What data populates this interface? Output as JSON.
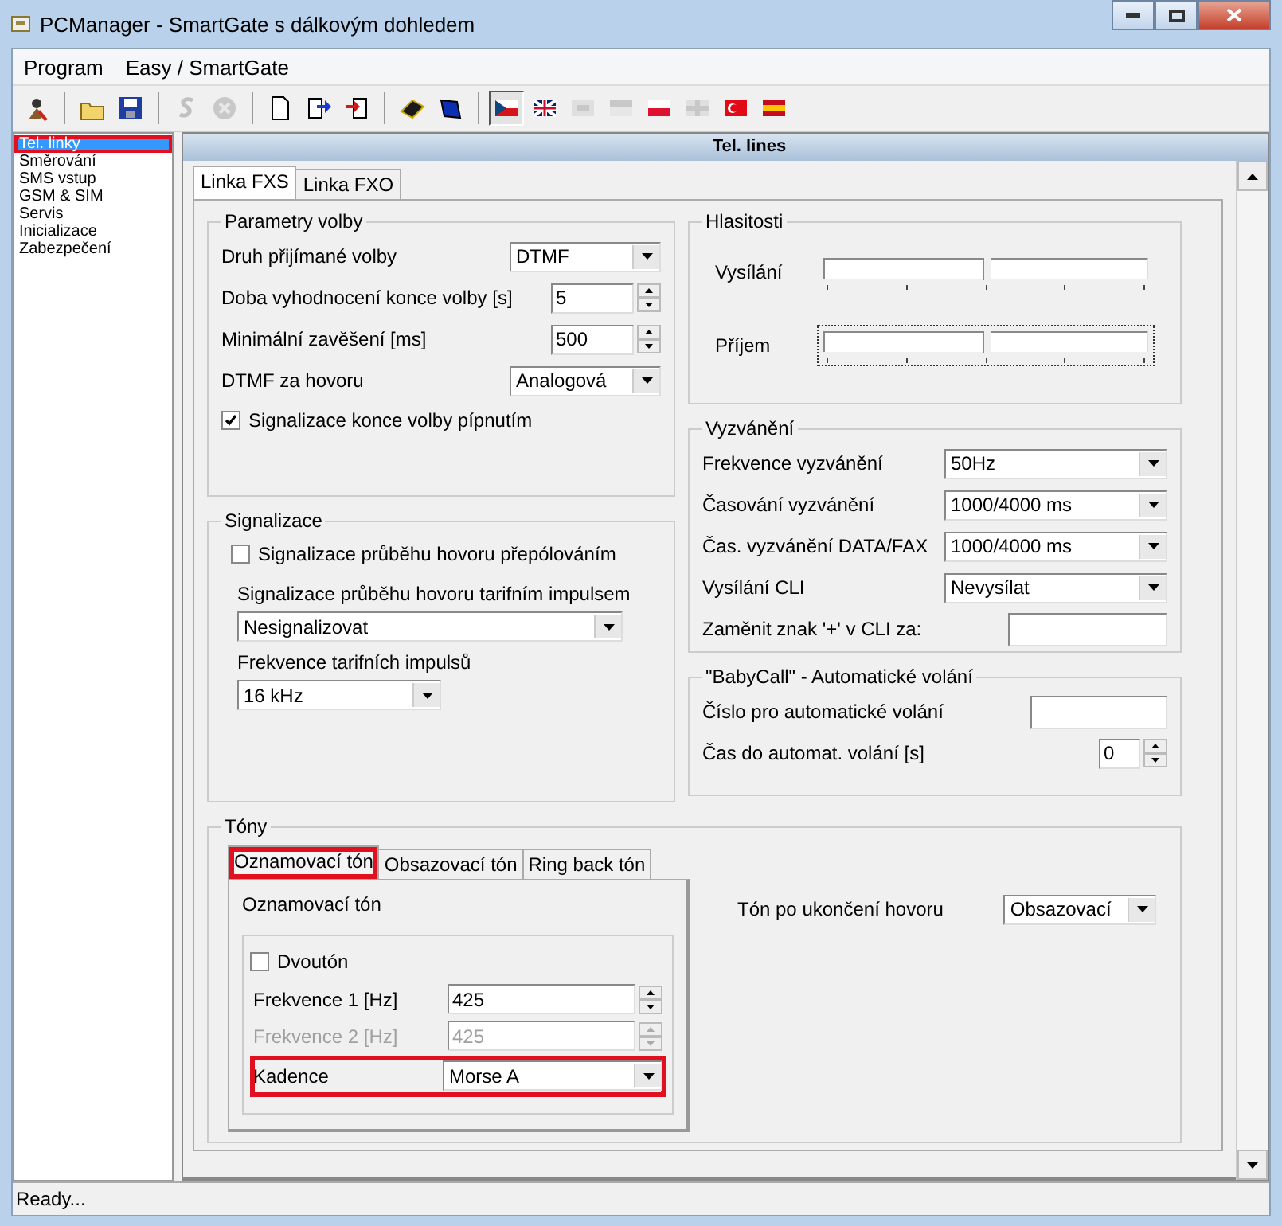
{
  "window": {
    "title": "PCManager - SmartGate s dálkovým dohledem"
  },
  "menu": [
    "Program",
    "Easy / SmartGate"
  ],
  "toolbar": [
    {
      "kind": "button",
      "disabled": false,
      "selected": false
    },
    {
      "kind": "separator"
    },
    {
      "kind": "button",
      "disabled": false,
      "selected": false
    },
    {
      "kind": "button",
      "disabled": false,
      "selected": false
    },
    {
      "kind": "separator"
    },
    {
      "kind": "button",
      "disabled": true,
      "selected": false
    },
    {
      "kind": "button",
      "disabled": true,
      "selected": false
    },
    {
      "kind": "separator"
    },
    {
      "kind": "button",
      "disabled": false,
      "selected": false
    },
    {
      "kind": "button",
      "disabled": false,
      "selected": false
    },
    {
      "kind": "button",
      "disabled": false,
      "selected": false
    },
    {
      "kind": "separator"
    },
    {
      "kind": "button",
      "disabled": false,
      "selected": false
    },
    {
      "kind": "button",
      "disabled": false,
      "selected": false
    },
    {
      "kind": "separator"
    },
    {
      "kind": "button",
      "disabled": false,
      "selected": true
    },
    {
      "kind": "button",
      "disabled": false,
      "selected": false
    },
    {
      "kind": "button",
      "disabled": true,
      "selected": false
    },
    {
      "kind": "button",
      "disabled": true,
      "selected": false
    },
    {
      "kind": "button",
      "disabled": false,
      "selected": false
    },
    {
      "kind": "button",
      "disabled": true,
      "selected": false
    },
    {
      "kind": "button",
      "disabled": false,
      "selected": false
    },
    {
      "kind": "button",
      "disabled": false,
      "selected": false
    }
  ],
  "sidebar": {
    "items": [
      {
        "label": "Tel. linky",
        "selected": true,
        "highlighted": true
      },
      {
        "label": "Směrování",
        "selected": false,
        "highlighted": false
      },
      {
        "label": "SMS vstup",
        "selected": false,
        "highlighted": false
      },
      {
        "label": "GSM & SIM",
        "selected": false,
        "highlighted": false
      },
      {
        "label": "Servis",
        "selected": false,
        "highlighted": false
      },
      {
        "label": "Inicializace",
        "selected": false,
        "highlighted": false
      },
      {
        "label": "Zabezpečení",
        "selected": false,
        "highlighted": false
      }
    ]
  },
  "panel": {
    "title": "Tel. lines",
    "tabs": [
      {
        "label": "Linka FXS",
        "selected": true
      },
      {
        "label": "Linka FXO",
        "selected": false
      }
    ],
    "parameters": {
      "title": "Parametry volby",
      "fields": [
        {
          "kind": "select",
          "label": "Druh přijímané volby",
          "value": "DTMF"
        },
        {
          "kind": "spin",
          "label": "Doba vyhodnocení konce volby [s]",
          "value": "5"
        },
        {
          "kind": "spin",
          "label": "Minimální zavěšení [ms]",
          "value": "500"
        },
        {
          "kind": "select",
          "label": "DTMF za hovoru",
          "value": "Analogová"
        },
        {
          "kind": "checkbox",
          "label": "Signalizace konce volby pípnutím",
          "checked": true
        }
      ]
    },
    "signaling": {
      "title": "Signalizace",
      "fields": [
        {
          "kind": "checkbox",
          "label": "Signalizace průběhu hovoru přepólováním",
          "checked": false
        },
        {
          "kind": "stacked_select",
          "label": "Signalizace průběhu hovoru tarifním impulsem",
          "value": "Nesignalizovat"
        },
        {
          "kind": "stacked_select",
          "label": "Frekvence tarifních impulsů",
          "value": "16 kHz"
        }
      ]
    },
    "volume": {
      "title": "Hlasitosti",
      "fields": [
        {
          "kind": "slider",
          "label": "Vysílání",
          "level": 0.5,
          "focused": false
        },
        {
          "kind": "slider",
          "label": "Příjem",
          "level": 0.5,
          "focused": true
        }
      ]
    },
    "ringing": {
      "title": "Vyzvánění",
      "fields": [
        {
          "kind": "select",
          "label": "Frekvence vyzvánění",
          "value": "50Hz"
        },
        {
          "kind": "select",
          "label": "Časování vyzvánění",
          "value": "1000/4000 ms"
        },
        {
          "kind": "select",
          "label": "Čas. vyzvánění DATA/FAX",
          "value": "1000/4000 ms"
        },
        {
          "kind": "select",
          "label": "Vysílání CLI",
          "value": "Nevysílat"
        },
        {
          "kind": "text",
          "label": "Zaměnit znak '+' v CLI za:"
        }
      ]
    },
    "babycall": {
      "title": "\"BabyCall\" - Automatické volání",
      "fields": [
        {
          "kind": "text",
          "label": "Číslo pro automatické volání"
        },
        {
          "kind": "spin",
          "label": "Čas do automat. volání [s]",
          "value": "0"
        }
      ]
    },
    "tones": {
      "title": "Tóny",
      "tabs": [
        {
          "label": "Oznamovací tón",
          "selected": true,
          "highlighted": true
        },
        {
          "label": "Obsazovací tón",
          "selected": false,
          "highlighted": false
        },
        {
          "label": "Ring back tón",
          "selected": false,
          "highlighted": false
        }
      ],
      "page_title": "Oznamovací tón",
      "fields": [
        {
          "kind": "checkbox",
          "label": "Dvoutón",
          "checked": false,
          "disabled": false,
          "highlighted": false
        },
        {
          "kind": "spin",
          "label": "Frekvence 1 [Hz]",
          "value": "425",
          "disabled": false,
          "highlighted": false
        },
        {
          "kind": "spin",
          "label": "Frekvence 2 [Hz]",
          "value": "425",
          "disabled": true,
          "highlighted": false
        },
        {
          "kind": "select",
          "label": "Kadence",
          "value": "Morse A",
          "disabled": false,
          "highlighted": true
        }
      ],
      "end_tone": {
        "label": "Tón po ukončení hovoru",
        "value": "Obsazovací"
      }
    }
  },
  "status_bar": {
    "text": "Ready..."
  }
}
